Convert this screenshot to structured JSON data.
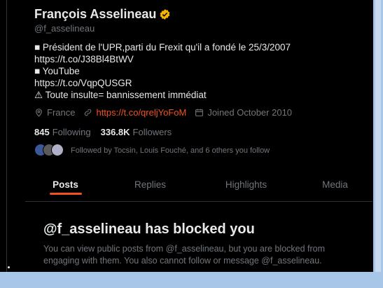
{
  "profile": {
    "name": "François Asselineau",
    "handle": "@f_asselineau",
    "verified_icon": "verified-badge-icon",
    "bio_lines": [
      "■ Président de l'UPR,parti du Frexit qu'il a fondé le 25/3/2007",
      "https://t.co/J38Bl4BtWV",
      "■ YouTube",
      "https://t.co/VqpQUSGR",
      "⚠ Toute insulte= bannissement immédiat"
    ],
    "location": "France",
    "website": "https://t.co/qreljYoFoM",
    "joined": "Joined October 2010",
    "following_count": "845",
    "following_label": "Following",
    "followers_count": "336.8K",
    "followers_label": "Followers",
    "followed_by": "Followed by Tocsin, Louis Fouché, and 6 others you follow"
  },
  "tabs": [
    {
      "label": "Posts",
      "active": true
    },
    {
      "label": "Replies",
      "active": false
    },
    {
      "label": "Highlights",
      "active": false
    },
    {
      "label": "Media",
      "active": false
    }
  ],
  "blocked": {
    "title": "@f_asselineau has blocked you",
    "text": "You can view public posts from @f_asselineau, but you are blocked from engaging with them. You also cannot follow or message @f_asselineau."
  },
  "colors": {
    "accent": "#f4511e",
    "verified": "#f4b400",
    "text": "#e7e9ea",
    "muted": "#71767b",
    "background": "#000000"
  }
}
